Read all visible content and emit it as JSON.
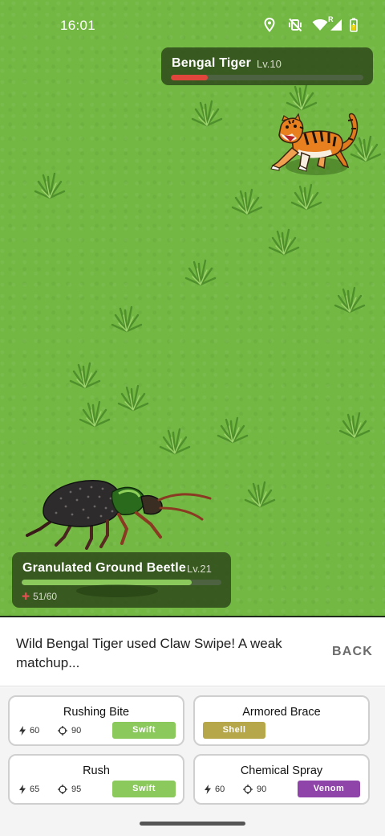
{
  "status_bar": {
    "time": "16:01",
    "icons": [
      "location-icon",
      "vibrate-off-icon",
      "wifi-icon",
      "signal-icon",
      "battery-icon"
    ],
    "signal_badge": "R"
  },
  "enemy": {
    "name": "Bengal Tiger",
    "level": "Lv.10",
    "hp_fraction": 0.19,
    "hp_color": "#e0463c"
  },
  "player": {
    "name": "Granulated Ground Beetle",
    "level": "Lv.21",
    "hp_text": "51/60",
    "hp_fraction": 0.85,
    "hp_color": "#8bc95d"
  },
  "dialog": {
    "message": "Wild Bengal Tiger used Claw Swipe! A weak matchup...",
    "back_label": "BACK"
  },
  "moves": [
    {
      "name": "Rushing Bite",
      "power": "60",
      "accuracy": "90",
      "type": "Swift",
      "type_color": "#8bc95d"
    },
    {
      "name": "Armored Brace",
      "power": "",
      "accuracy": "",
      "type": "Shell",
      "type_color": "#b5a74a"
    },
    {
      "name": "Rush",
      "power": "65",
      "accuracy": "95",
      "type": "Swift",
      "type_color": "#8bc95d"
    },
    {
      "name": "Chemical Spray",
      "power": "60",
      "accuracy": "90",
      "type": "Venom",
      "type_color": "#8e44a8"
    }
  ],
  "colors": {
    "grass": "#72b843",
    "panel": "#2f491a"
  }
}
